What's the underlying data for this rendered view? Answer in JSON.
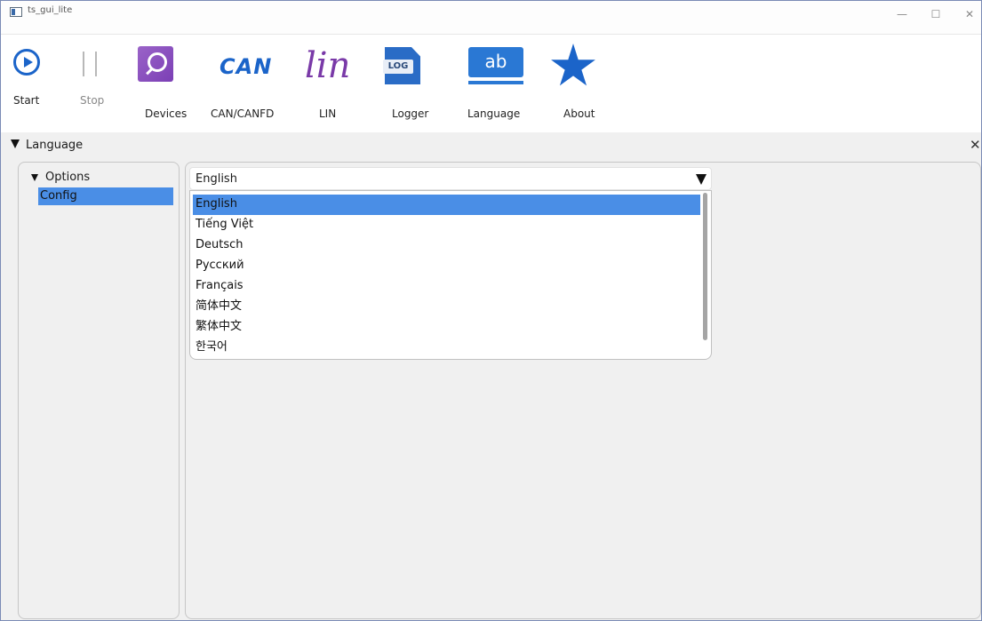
{
  "window": {
    "title": "ts_gui_lite",
    "minimize_glyph": "—",
    "maximize_glyph": "☐",
    "close_glyph": "✕"
  },
  "toolbar": {
    "start_label": "Start",
    "stop_label": "Stop",
    "devices_label": "Devices",
    "can_label": "CAN/CANFD",
    "can_icon_text": "CAN",
    "lin_label": "LIN",
    "lin_icon_text": "lin",
    "logger_label": "Logger",
    "logger_icon_text": "LOG",
    "language_label": "Language",
    "language_icon_text": "ab",
    "about_label": "About"
  },
  "panel": {
    "title": "Language",
    "close_glyph": "✕"
  },
  "tree": {
    "root": "Options",
    "selected_child": "Config"
  },
  "language_select": {
    "current": "English",
    "options": [
      "English",
      "Tiếng Việt",
      "Deutsch",
      "Русский",
      "Français",
      "简体中文",
      "繁体中文",
      "한국어"
    ],
    "highlighted": "English"
  },
  "colors": {
    "accent": "#1b64c9",
    "selection": "#4a8ee6",
    "devices_bg": "#8a4fc0",
    "lin_color": "#7a3aa8"
  }
}
